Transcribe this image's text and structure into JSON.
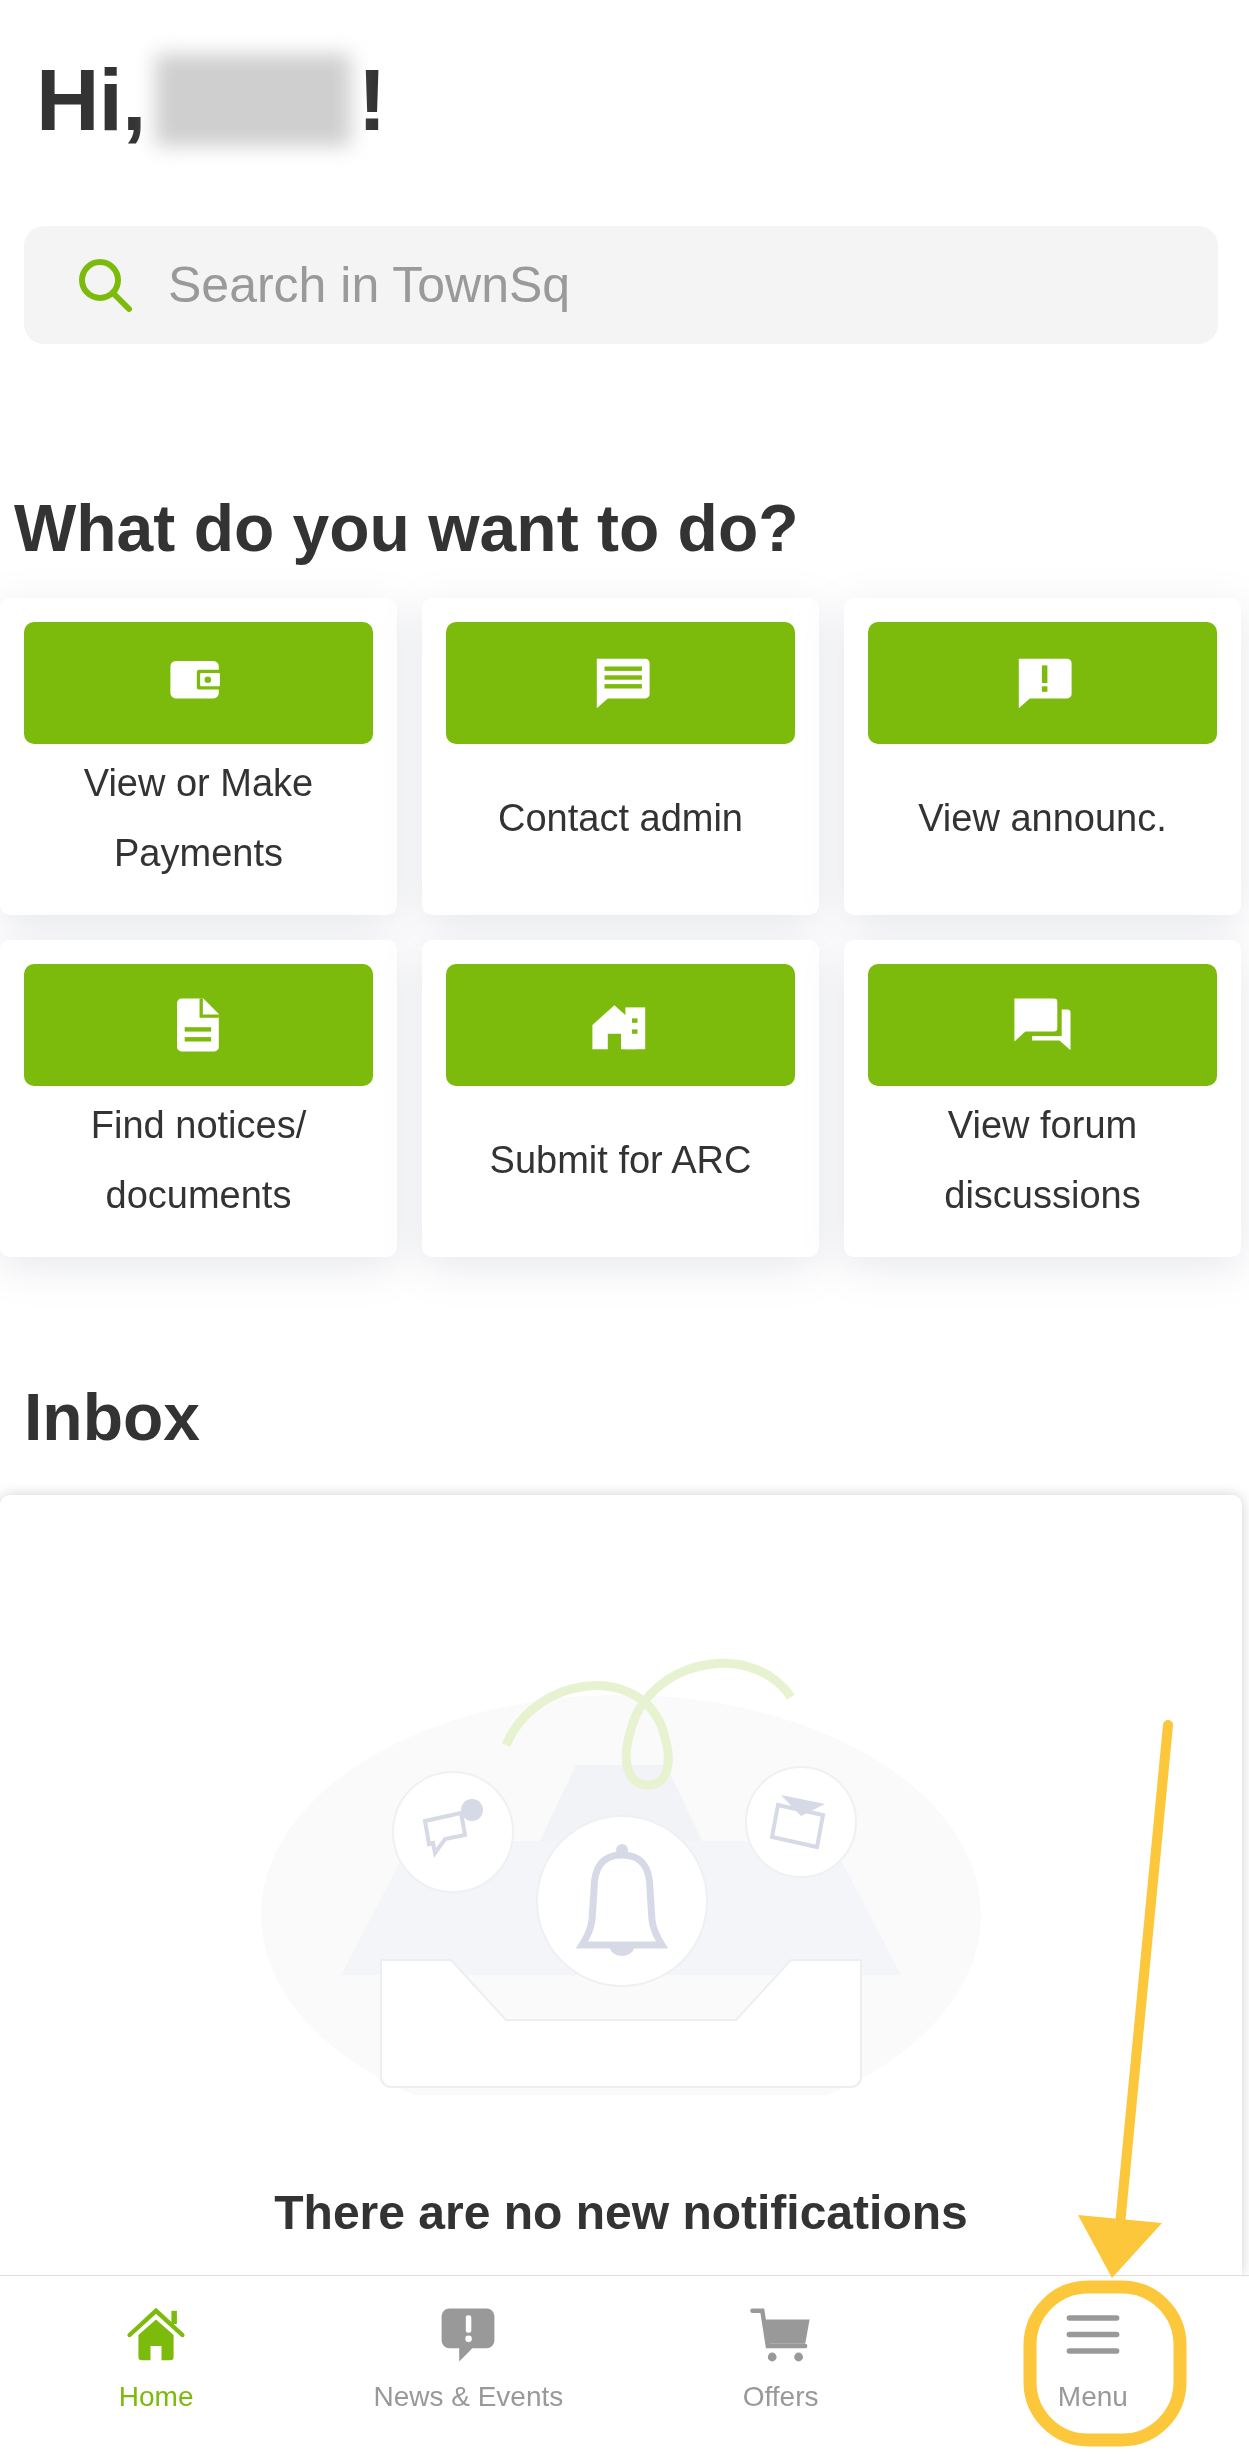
{
  "greeting": {
    "prefix": "Hi,",
    "suffix": "!"
  },
  "search": {
    "placeholder": "Search in TownSq"
  },
  "actions_title": "What do you want to do?",
  "actions": [
    {
      "label": "View or Make Payments",
      "kind": "wallet"
    },
    {
      "label": "Contact admin",
      "kind": "chat"
    },
    {
      "label": "View announc.",
      "kind": "alert"
    },
    {
      "label": "Find notices/ documents",
      "kind": "document"
    },
    {
      "label": "Submit for ARC",
      "kind": "houses"
    },
    {
      "label": "View forum discussions",
      "kind": "forum"
    }
  ],
  "inbox": {
    "title": "Inbox",
    "empty_message": "There are no new notifications"
  },
  "tab_bar": [
    {
      "label": "Home",
      "kind": "home",
      "selected": true
    },
    {
      "label": "News & Events",
      "kind": "news",
      "selected": false
    },
    {
      "label": "Offers",
      "kind": "cart",
      "selected": false
    },
    {
      "label": "Menu",
      "kind": "menu",
      "selected": false
    }
  ]
}
